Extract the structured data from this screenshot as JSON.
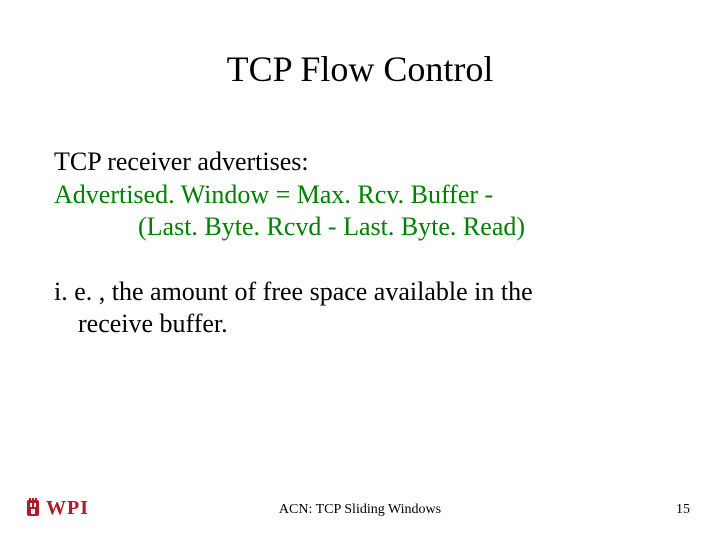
{
  "title": "TCP Flow Control",
  "body": {
    "line1": "TCP receiver advertises:",
    "line2": "Advertised. Window = Max. Rcv. Buffer -",
    "line3": "(Last. Byte. Rcvd  - Last. Byte. Read)",
    "line4": "i. e. , the amount of free space available in the",
    "line5": "receive buffer."
  },
  "footer": {
    "logo_text": "WPI",
    "center": "ACN: TCP Sliding Windows",
    "page": "15"
  },
  "colors": {
    "formula": "#008000",
    "logo": "#b11a2b"
  }
}
